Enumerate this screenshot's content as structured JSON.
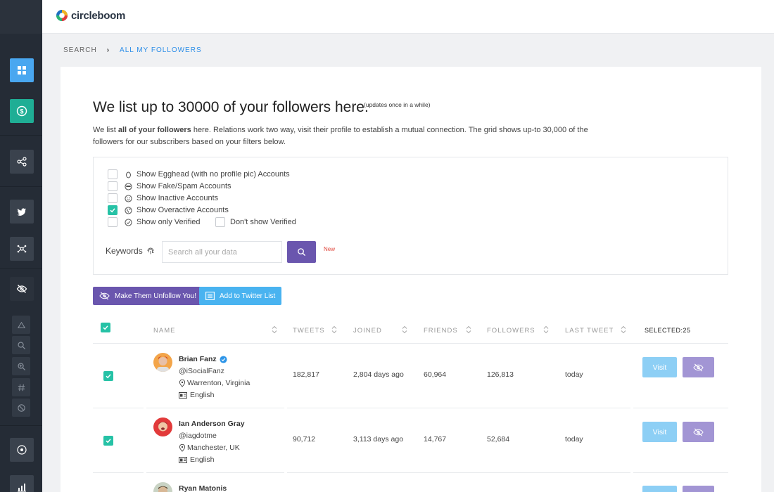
{
  "brand": {
    "logo_text": "circleboom"
  },
  "breadcrumb": {
    "parent": "SEARCH",
    "current": "ALL MY FOLLOWERS"
  },
  "intro": {
    "title": "We list up to 30000 of your followers here.",
    "title_note": "(updates once in a while)",
    "desc_before": "We list ",
    "desc_bold": "all of your followers",
    "desc_after": " here. Relations work two way, visit their profile to establish a mutual connection. The grid shows up-to 30,000 of the followers for our subscribers based on your filters below."
  },
  "filters": {
    "egghead": {
      "label": "Show Egghead (with no profile pic) Accounts",
      "checked": false
    },
    "fake": {
      "label": "Show Fake/Spam Accounts",
      "checked": false
    },
    "inactive": {
      "label": "Show Inactive Accounts",
      "checked": false
    },
    "overactive": {
      "label": "Show Overactive Accounts",
      "checked": true
    },
    "verified_only": {
      "label": "Show only Verified",
      "checked": false
    },
    "dont_show_verified": {
      "label": "Don't show Verified",
      "checked": false
    }
  },
  "keywords": {
    "label": "Keywords",
    "placeholder": "Search all your data",
    "new_badge": "New"
  },
  "actions": {
    "unfollow_label": "Make Them Unfollow You!",
    "add_list_label": "Add to Twitter List"
  },
  "table": {
    "headers": {
      "name": "NAME",
      "tweets": "TWEETS",
      "joined": "JOINED",
      "friends": "FRIENDS",
      "followers": "FOLLOWERS",
      "last_tweet": "LAST TWEET",
      "selected": "SELECTED:25"
    },
    "visit_label": "Visit",
    "rows": [
      {
        "name": "Brian Fanz",
        "verified": true,
        "handle": "@iSocialFanz",
        "location": "Warrenton, Virginia",
        "language": "English",
        "tweets": "182,817",
        "joined": "2,804 days ago",
        "friends": "60,964",
        "followers": "126,813",
        "last_tweet": "today",
        "checked": true
      },
      {
        "name": "Ian Anderson Gray",
        "verified": false,
        "handle": "@iagdotme",
        "location": "Manchester, UK",
        "language": "English",
        "tweets": "90,712",
        "joined": "3,113 days ago",
        "friends": "14,767",
        "followers": "52,684",
        "last_tweet": "today",
        "checked": true
      },
      {
        "name": "Ryan Matonis"
      }
    ]
  },
  "colors": {
    "purple": "#6a56ae",
    "blue": "#49b3f0",
    "teal": "#26c2a6",
    "sidebar": "#252c36"
  }
}
